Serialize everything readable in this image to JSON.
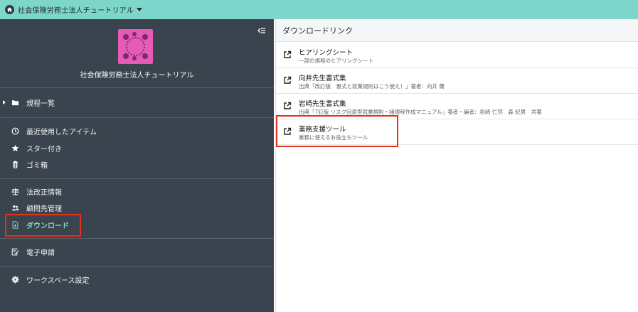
{
  "topbar": {
    "workspace_name": "社会保険労務士法人チュートリアル",
    "bg_color": "#7ed5c9"
  },
  "sidebar": {
    "workspace_title": "社会保険労務士法人チュートリアル",
    "logo_color": "#e45bb8",
    "sections": [
      {
        "items": [
          {
            "icon": "folder-icon",
            "label": "規程一覧"
          }
        ]
      },
      {
        "items": [
          {
            "icon": "clock-icon",
            "label": "最近使用したアイテム"
          },
          {
            "icon": "star-icon",
            "label": "スター付き"
          },
          {
            "icon": "trash-icon",
            "label": "ゴミ箱"
          }
        ]
      },
      {
        "items": [
          {
            "icon": "scale-icon",
            "label": "法改正情報"
          },
          {
            "icon": "people-icon",
            "label": "顧問先管理"
          },
          {
            "icon": "download-file-icon",
            "label": "ダウンロード",
            "active": true
          }
        ]
      },
      {
        "items": [
          {
            "icon": "e-application-icon",
            "label": "電子申請"
          }
        ]
      },
      {
        "items": [
          {
            "icon": "gear-icon",
            "label": "ワークスペース設定"
          }
        ]
      }
    ],
    "active_color": "#7ed5c9"
  },
  "main": {
    "header": "ダウンロードリンク",
    "links": [
      {
        "title": "ヒアリングシート",
        "subtitle": "一部の規程のヒアリングシート"
      },
      {
        "title": "向井先生書式集",
        "subtitle": "出典「改訂版　書式と就業規則はこう使え！」著者：向井 蘭"
      },
      {
        "title": "岩崎先生書式集",
        "subtitle": "出典「7訂版 リスク回避型就業規則・諸規程作成マニュアル」著者・編者：岩崎 仁弥　森 紀男　共著"
      },
      {
        "title": "業務支援ツール",
        "subtitle": "業務に使えるお役立ちツール"
      }
    ]
  },
  "annotation_color": "#e0321c"
}
